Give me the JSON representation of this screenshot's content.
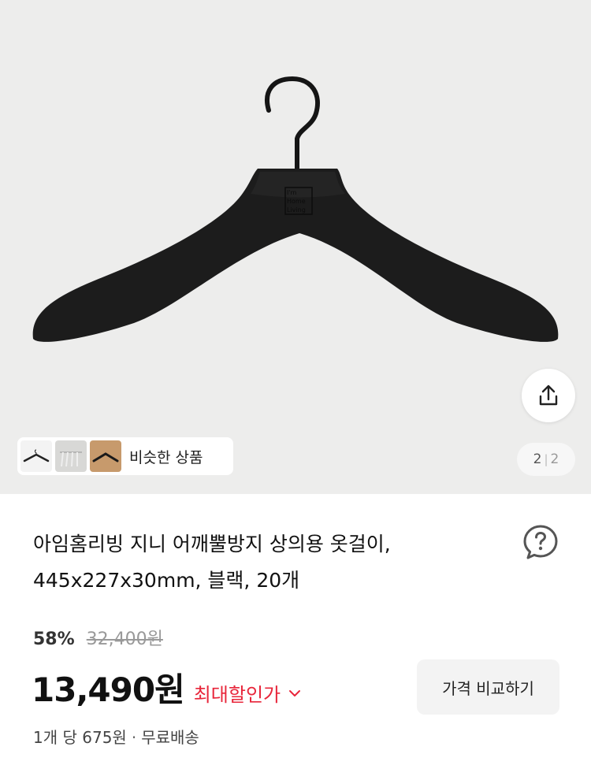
{
  "gallery": {
    "similar_label": "비슷한 상품",
    "page_current": "2",
    "page_separator": "|",
    "page_total": "2",
    "icons": [
      "share-icon"
    ],
    "logo_text": [
      "I'm",
      "Home",
      "Living"
    ]
  },
  "product": {
    "title_line1": "아임홈리빙 지니 어깨뿔방지 상의용 옷걸이,",
    "title_line2": "445x227x30mm, 블랙, 20개",
    "discount_rate": "58%",
    "original_price": "32,400원",
    "sale_price": "13,490원",
    "max_discount_label": "최대할인가",
    "compare_button": "가격 비교하기",
    "unit_price": "1개 당 675원",
    "separator": "·",
    "shipping": "무료배송"
  },
  "colors": {
    "accent_red": "#e8253a",
    "hero_background": "#ededec",
    "button_background": "#f3f3f3"
  }
}
